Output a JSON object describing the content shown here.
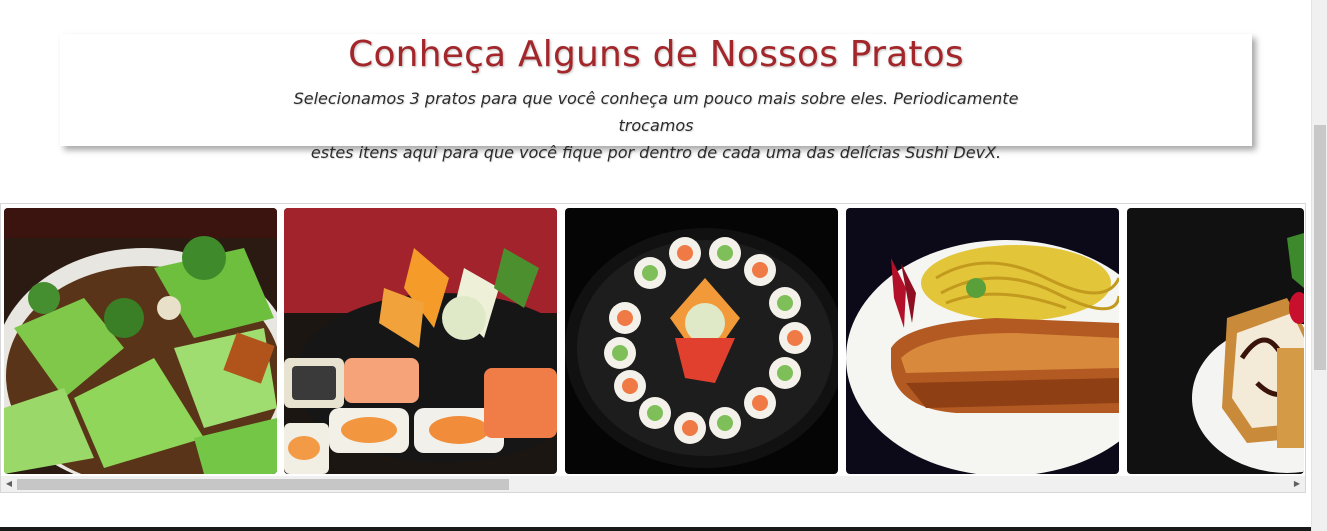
{
  "intro": {
    "title": "Conheça Alguns de Nossos Pratos",
    "text_line1": "Selecionamos 3 pratos para que você conheça um pouco mais sobre eles. Periodicamente trocamos",
    "text_line2": "estes itens aqui para que você fique por dentro de cada uma das delícias Sushi DevX."
  },
  "colors": {
    "title": "#a3262b",
    "text": "#2b2b2b"
  },
  "gallery": {
    "dishes": [
      "broccoli-cabbage-stir-fry-photo",
      "sushi-platter-with-vegetable-flower-photo",
      "round-sushi-tray-photo",
      "grilled-fish-with-noodles-photo",
      "fried-roll-with-chocolate-sauce-photo"
    ]
  },
  "icons": {
    "scroll_left": "◀",
    "scroll_right": "▶"
  }
}
